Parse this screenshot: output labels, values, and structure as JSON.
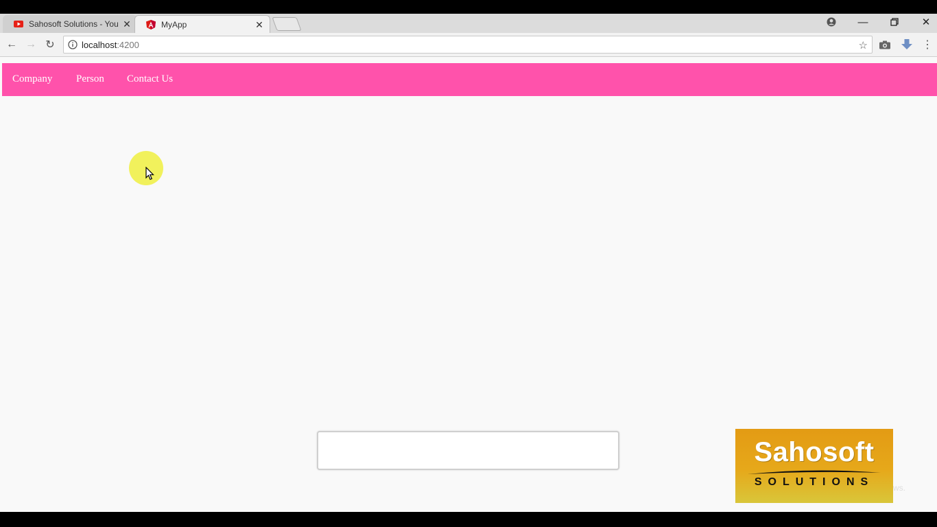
{
  "browser": {
    "tabs": [
      {
        "title": "Sahosoft Solutions - You",
        "icon": "youtube-icon",
        "active": false
      },
      {
        "title": "MyApp",
        "icon": "angular-icon",
        "active": true
      }
    ],
    "address": {
      "host": "localhost",
      "port": ":4200"
    }
  },
  "app": {
    "nav": [
      {
        "label": "Company"
      },
      {
        "label": "Person"
      },
      {
        "label": "Contact Us"
      }
    ],
    "nav_color": "#ff52ab"
  },
  "watermark": {
    "brand": "Sahosoft",
    "sub": "SOLUTIONS",
    "trailing": "ws."
  }
}
